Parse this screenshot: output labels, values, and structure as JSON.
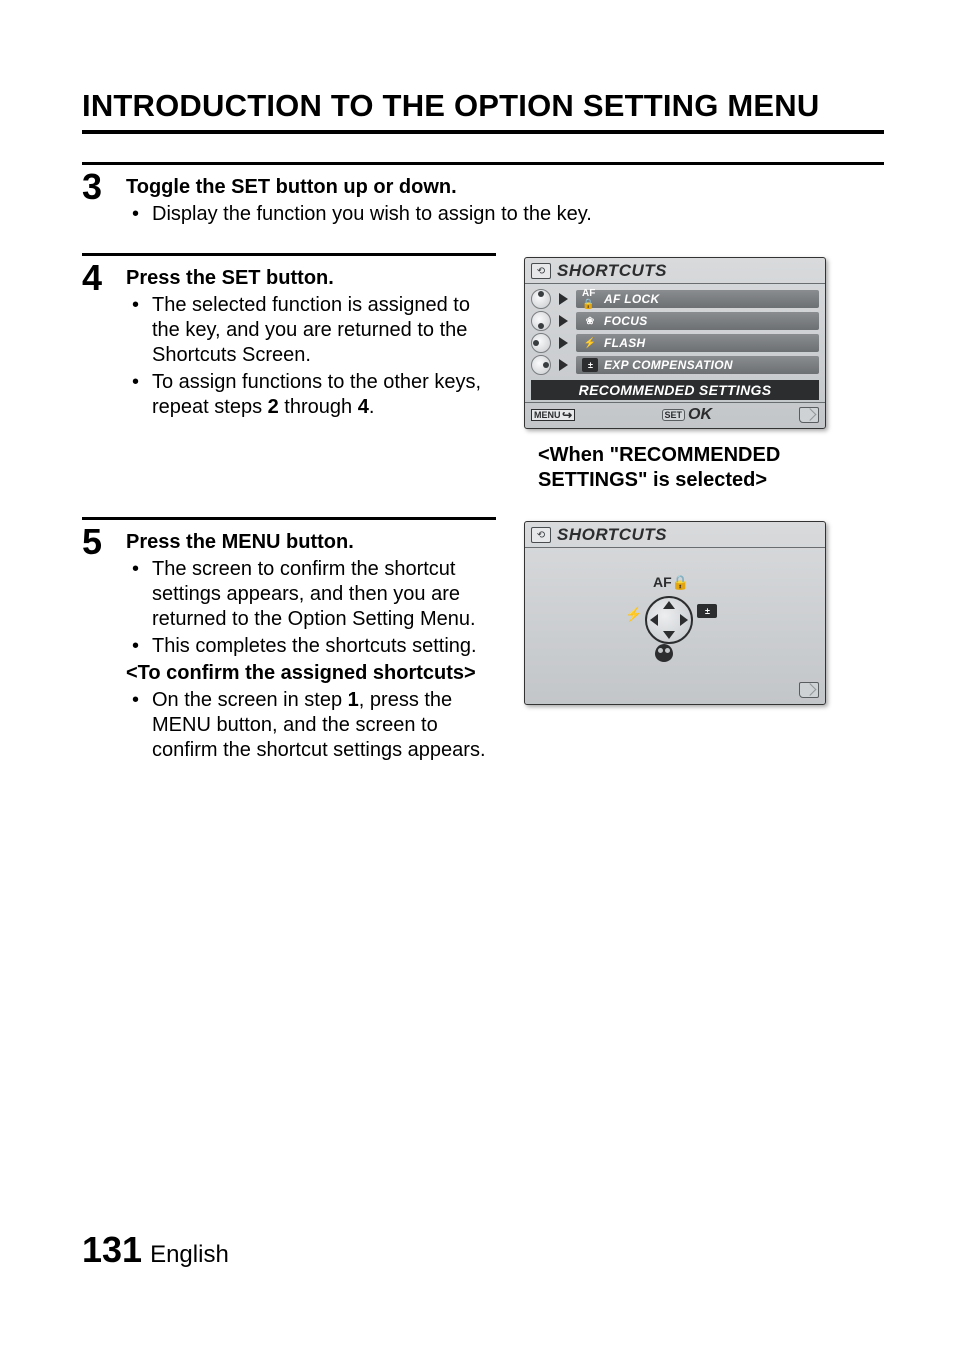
{
  "title": "INTRODUCTION TO THE OPTION SETTING MENU",
  "steps": {
    "s3": {
      "num": "3",
      "head": "Toggle the SET button up or down.",
      "b1": "Display the function you wish to assign to the key."
    },
    "s4": {
      "num": "4",
      "head": "Press the SET button.",
      "b1": "The selected function is assigned to the key, and you are returned to the Shortcuts Screen.",
      "b2_pre": "To assign functions to the other keys, repeat steps ",
      "b2_bold1": "2",
      "b2_mid": " through ",
      "b2_bold2": "4",
      "b2_post": "."
    },
    "s5": {
      "num": "5",
      "head": "Press the MENU button.",
      "b1": "The screen to confirm the shortcut settings appears, and then you are returned to the Option Setting Menu.",
      "b2": "This completes the shortcuts setting.",
      "sub": "<To confirm the assigned shortcuts>",
      "b3_pre": "On the screen in step ",
      "b3_bold": "1",
      "b3_post": ", press the MENU button, and the screen to confirm the shortcut settings appears."
    }
  },
  "lcd1": {
    "title": "SHORTCUTS",
    "row1": "AF LOCK",
    "row1icon": "AF🔒",
    "row2": "FOCUS",
    "row3": "FLASH",
    "row4": "EXP COMPENSATION",
    "rec": "RECOMMENDED SETTINGS",
    "menu": "MENU",
    "set": "SET",
    "ok": "OK"
  },
  "lcd1_caption_line1": "<When \"RECOMMENDED",
  "lcd1_caption_line2": "SETTINGS\" is selected>",
  "lcd2": {
    "title": "SHORTCUTS",
    "top": "AF🔒",
    "left": "⚡",
    "right_alt": "±"
  },
  "footer": {
    "page": "131",
    "lang": "English"
  }
}
